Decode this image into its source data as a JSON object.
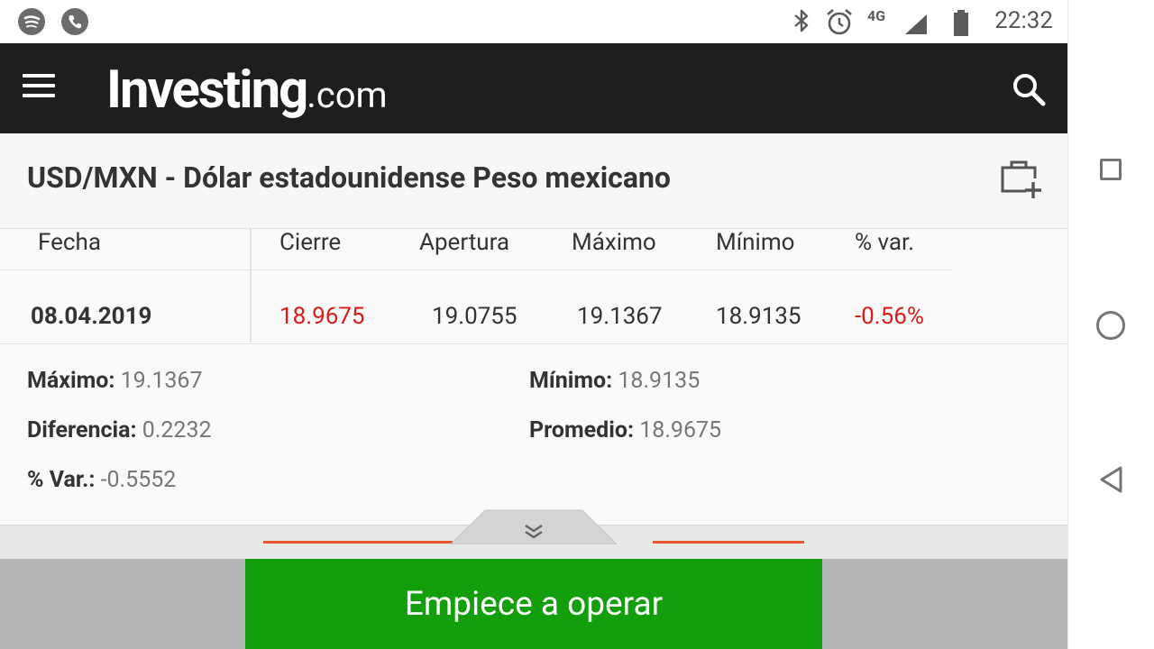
{
  "status_bar": {
    "time": "22:32",
    "network": "4G",
    "left_icons": [
      "spotify-icon",
      "phone-icon"
    ],
    "right_icons": [
      "bluetooth-icon",
      "alarm-icon",
      "signal-icon",
      "battery-icon"
    ]
  },
  "header": {
    "logo_main": "Investing",
    "logo_suffix": ".com"
  },
  "page": {
    "title": "USD/MXN - Dólar estadounidense Peso mexicano"
  },
  "table": {
    "headers": [
      "Fecha",
      "Cierre",
      "Apertura",
      "Máximo",
      "Mínimo",
      "% var."
    ],
    "row": {
      "fecha": "08.04.2019",
      "cierre": "18.9675",
      "apertura": "19.0755",
      "maximo": "19.1367",
      "minimo": "18.9135",
      "var": "-0.56%"
    }
  },
  "details": {
    "maximo_label": "Máximo:",
    "maximo_value": "19.1367",
    "minimo_label": "Mínimo:",
    "minimo_value": "18.9135",
    "diferencia_label": "Diferencia:",
    "diferencia_value": "0.2232",
    "promedio_label": "Promedio:",
    "promedio_value": "18.9675",
    "var_label": "% Var.:",
    "var_value": "-0.5552"
  },
  "cta": {
    "label": "Empiece a operar"
  },
  "colors": {
    "header_bg": "#1e1e1e",
    "negative": "#d91e18",
    "cta_bg": "#139e0b",
    "accent_orange": "#e55a2b"
  }
}
